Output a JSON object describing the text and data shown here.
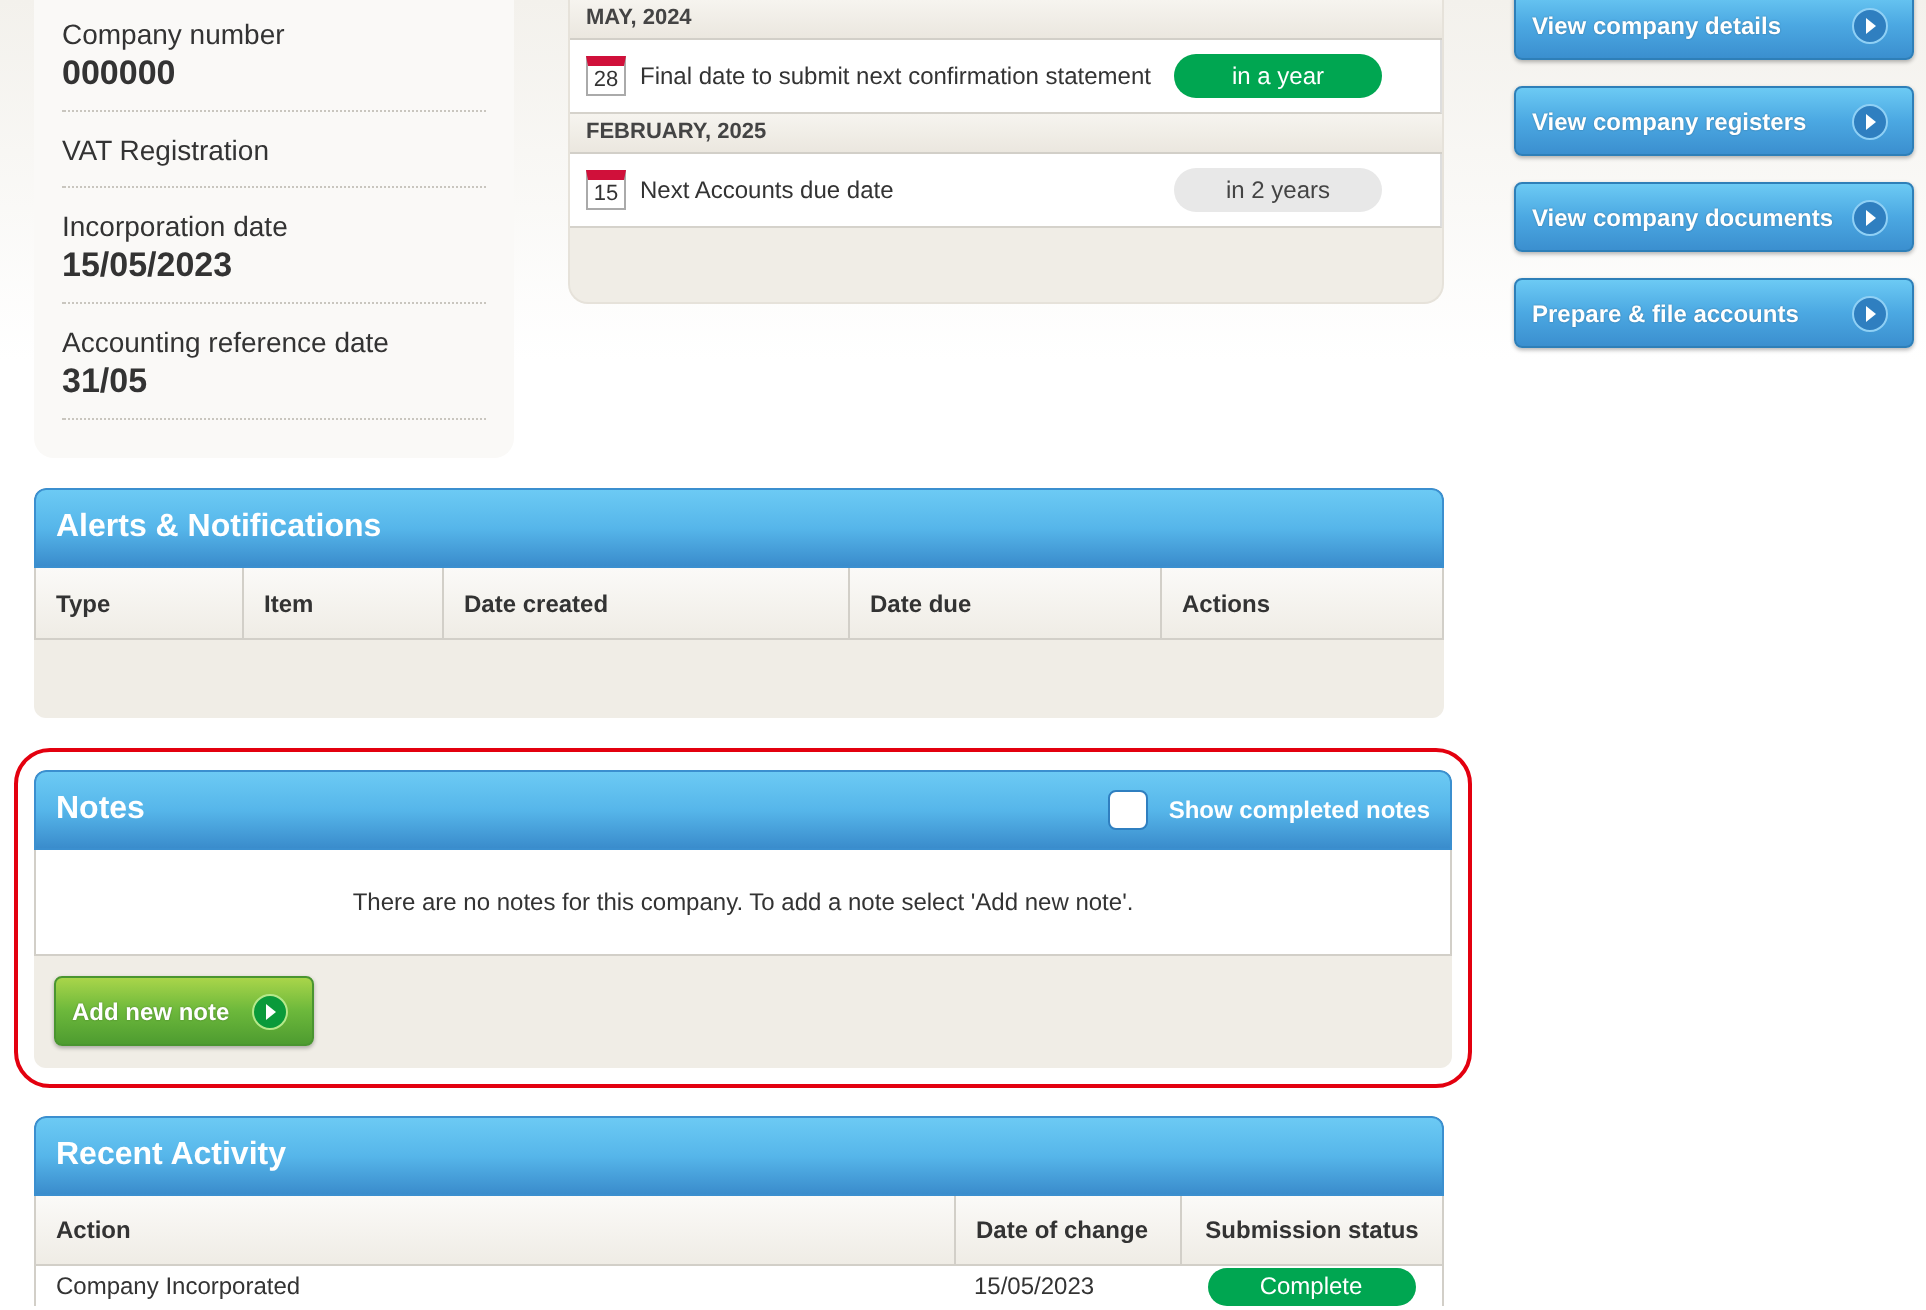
{
  "company_info": [
    {
      "label": "Company number",
      "value": "000000"
    },
    {
      "label": "VAT Registration"
    },
    {
      "label": "Incorporation date",
      "value": "15/05/2023"
    },
    {
      "label": "Accounting reference date",
      "value": "31/05"
    }
  ],
  "deadlines": [
    {
      "month": "MAY, 2024",
      "items": [
        {
          "day": "28",
          "text": "Final date to submit next confirmation statement",
          "due": "in a year",
          "color": "#00a651"
        }
      ]
    },
    {
      "month": "FEBRUARY, 2025",
      "items": [
        {
          "day": "15",
          "text": "Next Accounts due date",
          "due": "in 2 years",
          "color": "#e8e8e8"
        }
      ]
    }
  ],
  "actions": [
    "View company details",
    "View company registers",
    "View company documents",
    "Prepare & file accounts"
  ],
  "alerts": {
    "title": "Alerts & Notifications",
    "columns": [
      "Type",
      "Item",
      "Date created",
      "Date due",
      "Actions"
    ]
  },
  "notes": {
    "title": "Notes",
    "highlighted": true,
    "show_completed": {
      "label": "Show completed notes",
      "checked": false
    },
    "empty_message": "There are no notes for this company. To add a note select 'Add new note'.",
    "add_button": "Add new note"
  },
  "recent_activity": {
    "title": "Recent Activity",
    "columns": [
      "Action",
      "Date of change",
      "Submission status"
    ],
    "rows": [
      {
        "action": "Company Incorporated",
        "date": "15/05/2023",
        "status": "Complete"
      }
    ]
  }
}
